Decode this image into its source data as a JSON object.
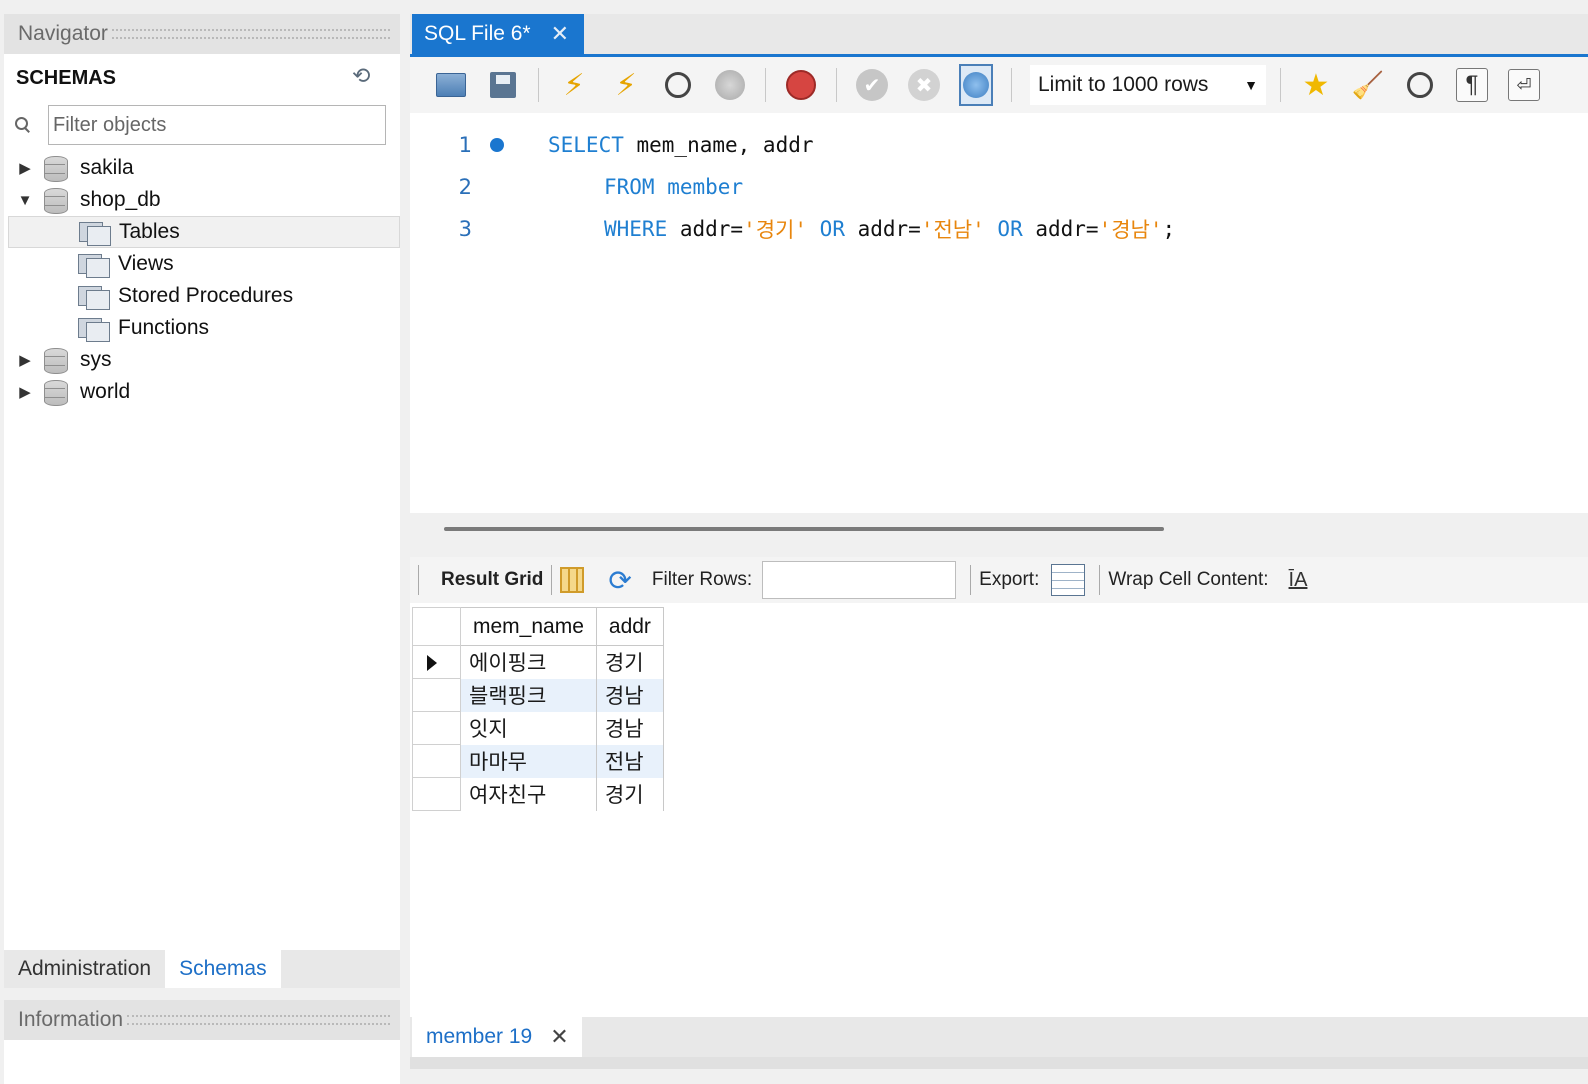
{
  "navigator": {
    "title": "Navigator",
    "schemas_label": "SCHEMAS",
    "filter_placeholder": "Filter objects",
    "tree": {
      "sakila": "sakila",
      "shop_db": "shop_db",
      "tables": "Tables",
      "views": "Views",
      "stored_procedures": "Stored Procedures",
      "functions": "Functions",
      "sys": "sys",
      "world": "world"
    },
    "tabs": {
      "administration": "Administration",
      "schemas": "Schemas"
    },
    "information_title": "Information"
  },
  "editor": {
    "tab_title": "SQL File 6*",
    "limit_option": "Limit to 1000 rows",
    "lines": [
      {
        "num": "1",
        "parts": [
          "SELECT",
          " mem_name, addr"
        ]
      },
      {
        "num": "2",
        "parts": [
          "FROM",
          " ",
          "member"
        ]
      },
      {
        "num": "3",
        "parts": [
          "WHERE",
          " addr=",
          "'경기'",
          " ",
          "OR",
          " addr=",
          "'전남'",
          " ",
          "OR",
          " addr=",
          "'경남'",
          ";"
        ]
      }
    ]
  },
  "result": {
    "result_grid_label": "Result Grid",
    "filter_rows_label": "Filter Rows:",
    "export_label": "Export:",
    "wrap_label": "Wrap Cell Content:",
    "wrap_icon_text": "ĪA",
    "columns": [
      "mem_name",
      "addr"
    ],
    "rows": [
      [
        "에이핑크",
        "경기"
      ],
      [
        "블랙핑크",
        "경남"
      ],
      [
        "잇지",
        "경남"
      ],
      [
        "마마무",
        "전남"
      ],
      [
        "여자친구",
        "경기"
      ]
    ],
    "bottom_tab": "member 19"
  },
  "colors": {
    "accent": "#1a76cf",
    "keyword": "#1f7fd1",
    "string": "#e8860d"
  }
}
